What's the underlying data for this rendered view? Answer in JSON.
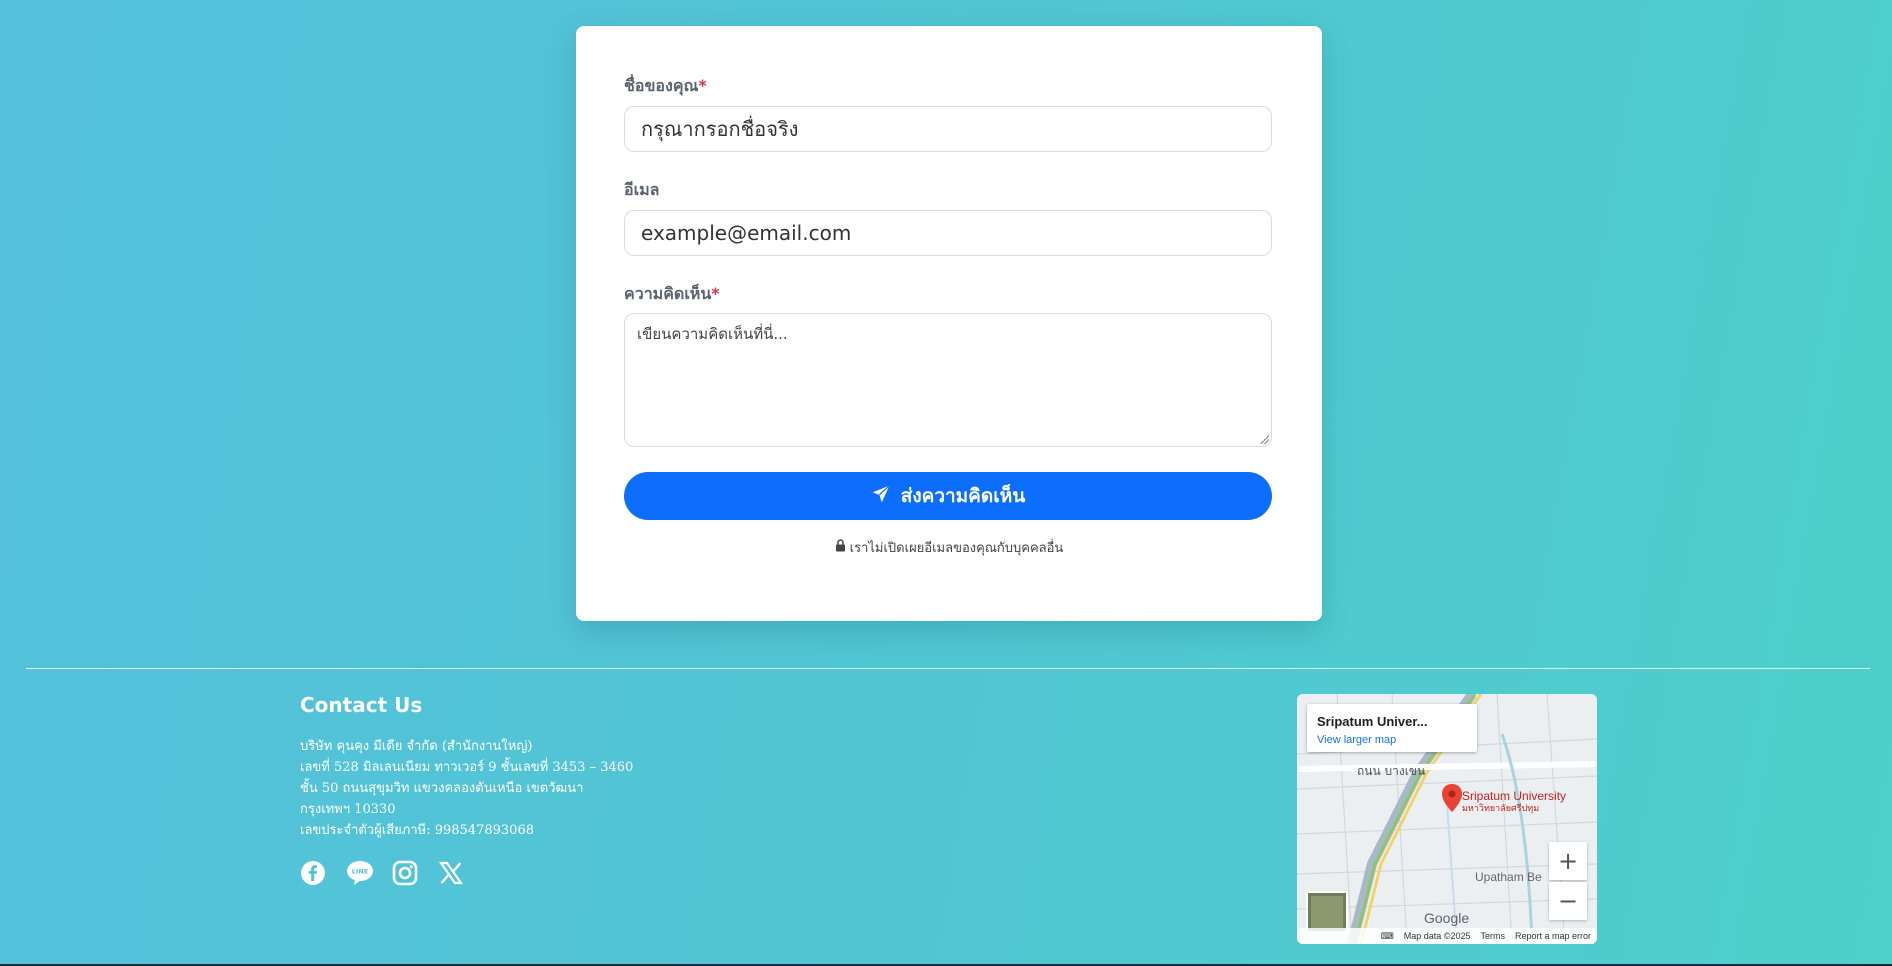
{
  "form": {
    "name_label": "ชื่อของคุณ",
    "required_mark": "*",
    "name_value": "กรุณากรอกชื่อจริง",
    "email_label": "อีเมล",
    "email_value": "example@email.com",
    "comment_label": "ความคิดเห็น",
    "comment_placeholder": "เขียนความคิดเห็นที่นี่...",
    "submit_label": "ส่งความคิดเห็น",
    "privacy_note": "เราไม่เปิดเผยอีเมลของคุณกับบุคคลอื่น"
  },
  "footer": {
    "contact_title": "Contact Us",
    "address_lines": [
      "บริษัท คุนคุง มีเดีย จำกัด (สำนักงานใหญ่)",
      "เลขที่ 528 มิลเลนเนียม ทาวเวอร์ 9 ชั้นเลขที่ 3453 – 3460",
      "ชั้น 50 ถนนสุขุมวิท แขวงคลองตันเหนือ เขตวัฒนา",
      "กรุงเทพฯ 10330",
      "เลขประจำตัวผู้เสียภาษี: 998547893068"
    ],
    "social": [
      "facebook-icon",
      "line-icon",
      "instagram-icon",
      "x-icon"
    ]
  },
  "map": {
    "place_title": "Sripatum Univer...",
    "larger_map_link": "View larger map",
    "marker_label": "Sripatum University",
    "marker_label_thai": "มหาวิทยาลัยศรีปทุม",
    "road_label": "ถนน บางเขน",
    "area_label": "Upatham Be",
    "zoom_in": "+",
    "zoom_out": "−",
    "google": "Google",
    "map_data": "Map data ©2025",
    "terms": "Terms",
    "report": "Report a map error"
  },
  "colors": {
    "accent": "#0d6efd",
    "required": "#dc3545"
  }
}
